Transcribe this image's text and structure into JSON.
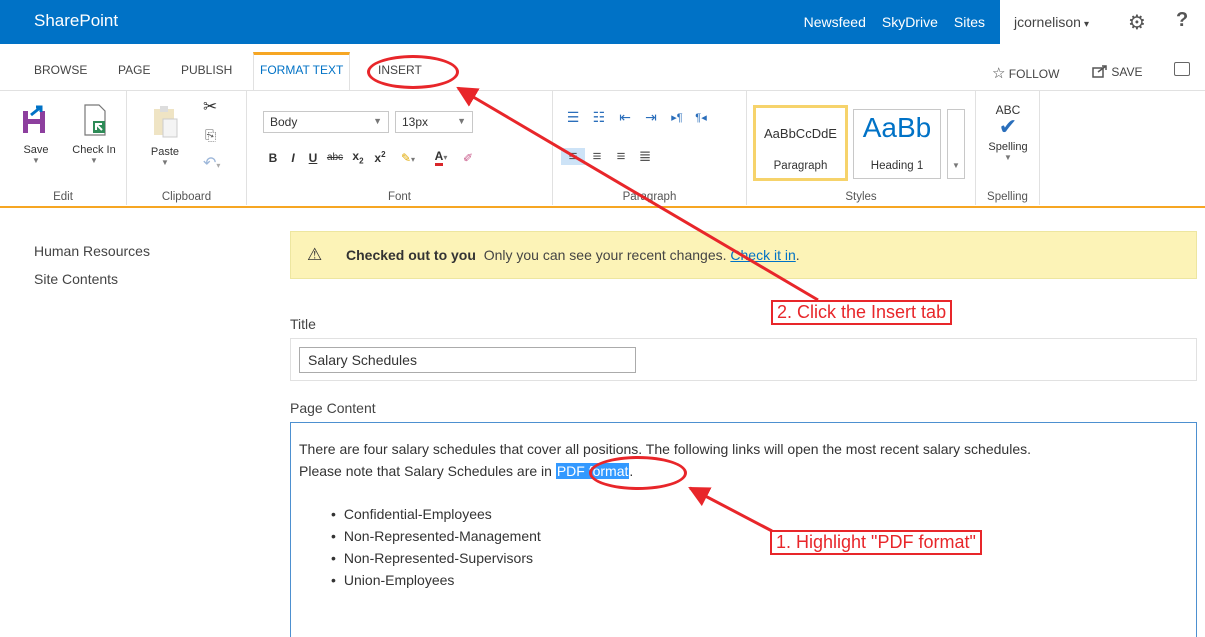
{
  "suitebar": {
    "brand": "SharePoint",
    "links": [
      "Newsfeed",
      "SkyDrive",
      "Sites"
    ],
    "user": "jcornelison"
  },
  "tabs": {
    "browse": "BROWSE",
    "page": "PAGE",
    "publish": "PUBLISH",
    "format_text": "FORMAT TEXT",
    "insert": "INSERT",
    "follow": "FOLLOW",
    "save": "SAVE"
  },
  "ribbon": {
    "edit": {
      "save": "Save",
      "check_in": "Check In",
      "label": "Edit"
    },
    "clipboard": {
      "paste": "Paste",
      "label": "Clipboard"
    },
    "font": {
      "style_value": "Body",
      "size_value": "13px",
      "label": "Font"
    },
    "paragraph": {
      "label": "Paragraph"
    },
    "styles": {
      "preview1": "AaBbCcDdE",
      "name1": "Paragraph",
      "preview2": "AaBb",
      "name2": "Heading 1",
      "label": "Styles"
    },
    "spelling": {
      "abc": "ABC",
      "button": "Spelling",
      "label": "Spelling"
    }
  },
  "leftnav": {
    "items": [
      "Human Resources",
      "Site Contents"
    ]
  },
  "notice": {
    "bold": "Checked out to you",
    "text": "Only you can see your recent changes.",
    "link": "Check it in"
  },
  "form": {
    "title_label": "Title",
    "title_value": "Salary Schedules",
    "content_label": "Page Content",
    "line1": "There are four salary schedules that cover all positions. The following links will open the most recent salary schedules.",
    "line2_before": "Please note that Salary Schedules are in",
    "line2_highlight": "PDF format",
    "line2_after": ".",
    "bullets": [
      "Confidential-Employees",
      "Non-Represented-Management",
      "Non-Represented-Supervisors",
      "Union-Employees"
    ]
  },
  "annotations": {
    "step1": "1. Highlight \"PDF format\"",
    "step2": "2. Click the Insert tab",
    "color": "#e8262a"
  },
  "colors": {
    "suitebar": "#0072c6",
    "accent_orange": "#f6a623",
    "notice_bg": "#fcf3b7",
    "highlight": "#3399ff"
  }
}
